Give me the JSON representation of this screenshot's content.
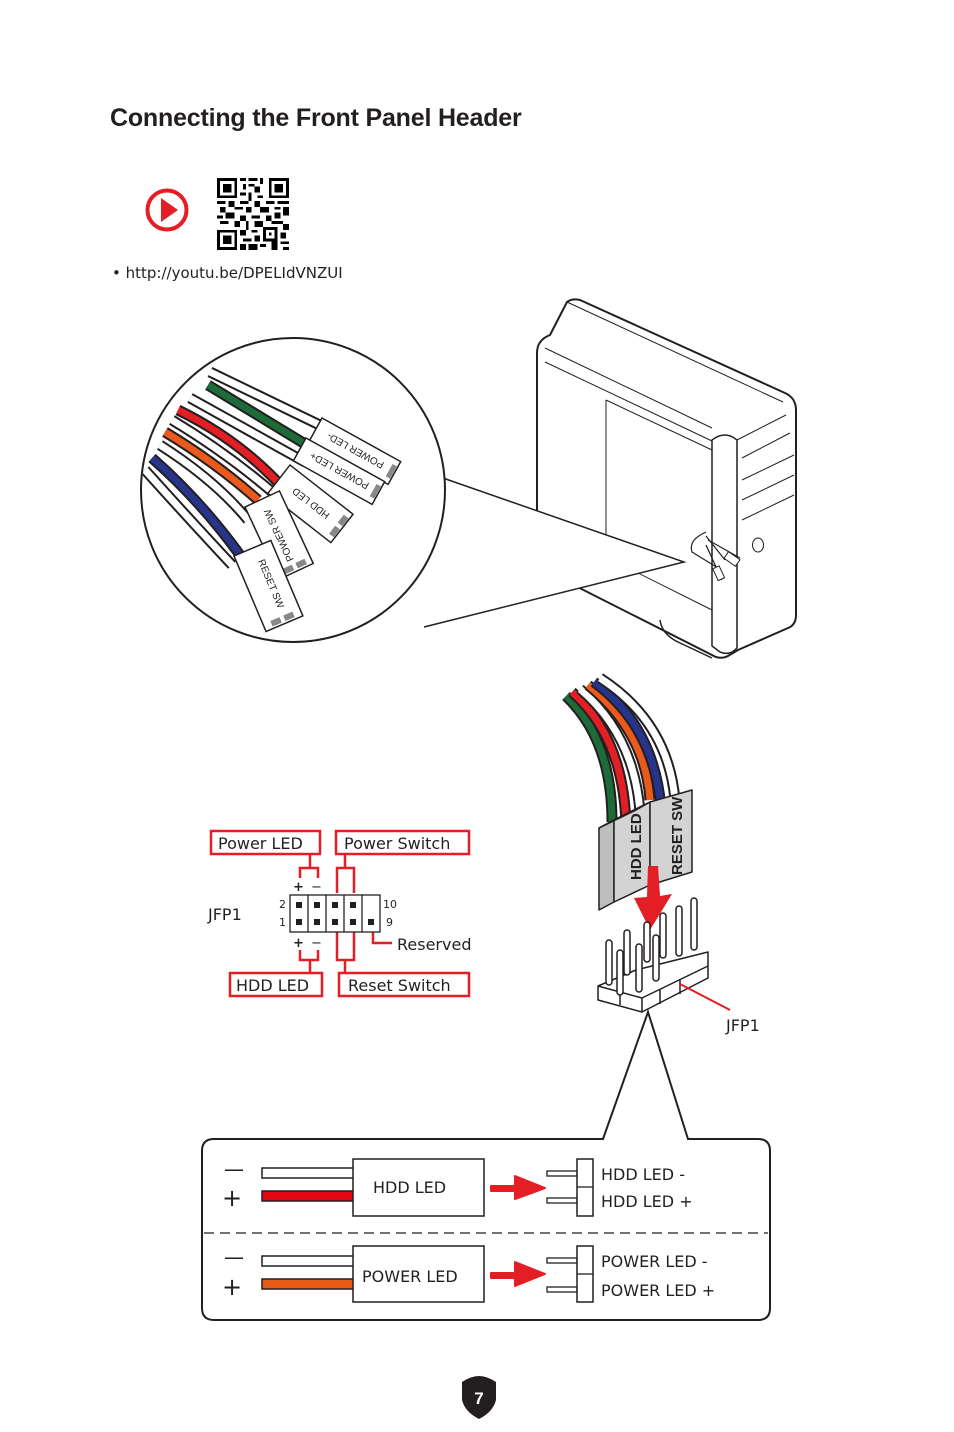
{
  "page": {
    "title": "Connecting the Front Panel Header",
    "video_url": "• http://youtu.be/DPELIdVNZUI",
    "page_number": "7"
  },
  "icons": {
    "play": "play-icon",
    "qr": "qr-code"
  },
  "colors": {
    "accent_red": "#e31e24",
    "wire_green": "#1e6b3a",
    "wire_red": "#e31e24",
    "wire_orange": "#ea5a1c",
    "wire_blue": "#27348b",
    "connector_gray": "#d3d3d3"
  },
  "cable_callout": {
    "connectors": [
      "POWER LED-",
      "POWER LED+",
      "HDD LED",
      "POWER SW",
      "RESET SW"
    ]
  },
  "jfp1_diagram": {
    "header_label": "JFP1",
    "pin_numbers": {
      "top_left": "2",
      "bottom_left": "1",
      "top_right": "10",
      "bottom_right": "9"
    },
    "callouts": {
      "power_led": "Power LED",
      "power_switch": "Power Switch",
      "hdd_led": "HDD LED",
      "reset_switch": "Reset Switch",
      "reserved": "Reserved"
    },
    "polarity": {
      "plus": "+",
      "minus": "−"
    }
  },
  "connector_3d": {
    "left_block": "HDD LED",
    "right_block": "RESET SW",
    "header_label": "JFP1"
  },
  "polarity_box": {
    "rows": [
      {
        "minus": "—",
        "plus": "+",
        "connector": "HDD LED",
        "pin_minus": "HDD LED -",
        "pin_plus": "HDD LED +",
        "plus_wire_color": "#e30613"
      },
      {
        "minus": "—",
        "plus": "+",
        "connector": "POWER LED",
        "pin_minus": "POWER LED -",
        "pin_plus": "POWER LED +",
        "plus_wire_color": "#e85b17"
      }
    ]
  }
}
